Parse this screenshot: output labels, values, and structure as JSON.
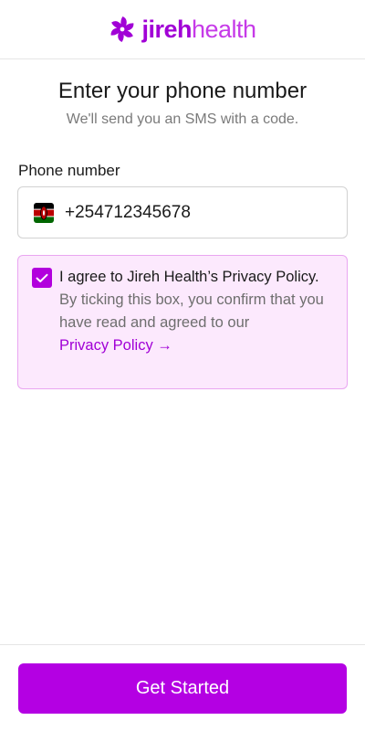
{
  "colors": {
    "brand": "#b400e3",
    "brand_text": "#a100d6",
    "consent_background": "#fce9fd",
    "consent_border": "#e9a6f1"
  },
  "header": {
    "logo_bold": "jireh",
    "logo_light": "health",
    "logo_icon": "jireh-pinwheel-logo-icon"
  },
  "main": {
    "title": "Enter your phone number",
    "subtitle": "We'll send you an SMS with a code."
  },
  "phone": {
    "label": "Phone number",
    "country_icon": "kenya-flag-icon",
    "value": "+254712345678"
  },
  "consent": {
    "checked": true,
    "title": "I agree to Jireh Health’s Privacy Policy.",
    "body": "By ticking this box, you confirm that you have read and agreed to our",
    "link_text": "Privacy Policy →"
  },
  "footer": {
    "cta_label": "Get Started"
  }
}
